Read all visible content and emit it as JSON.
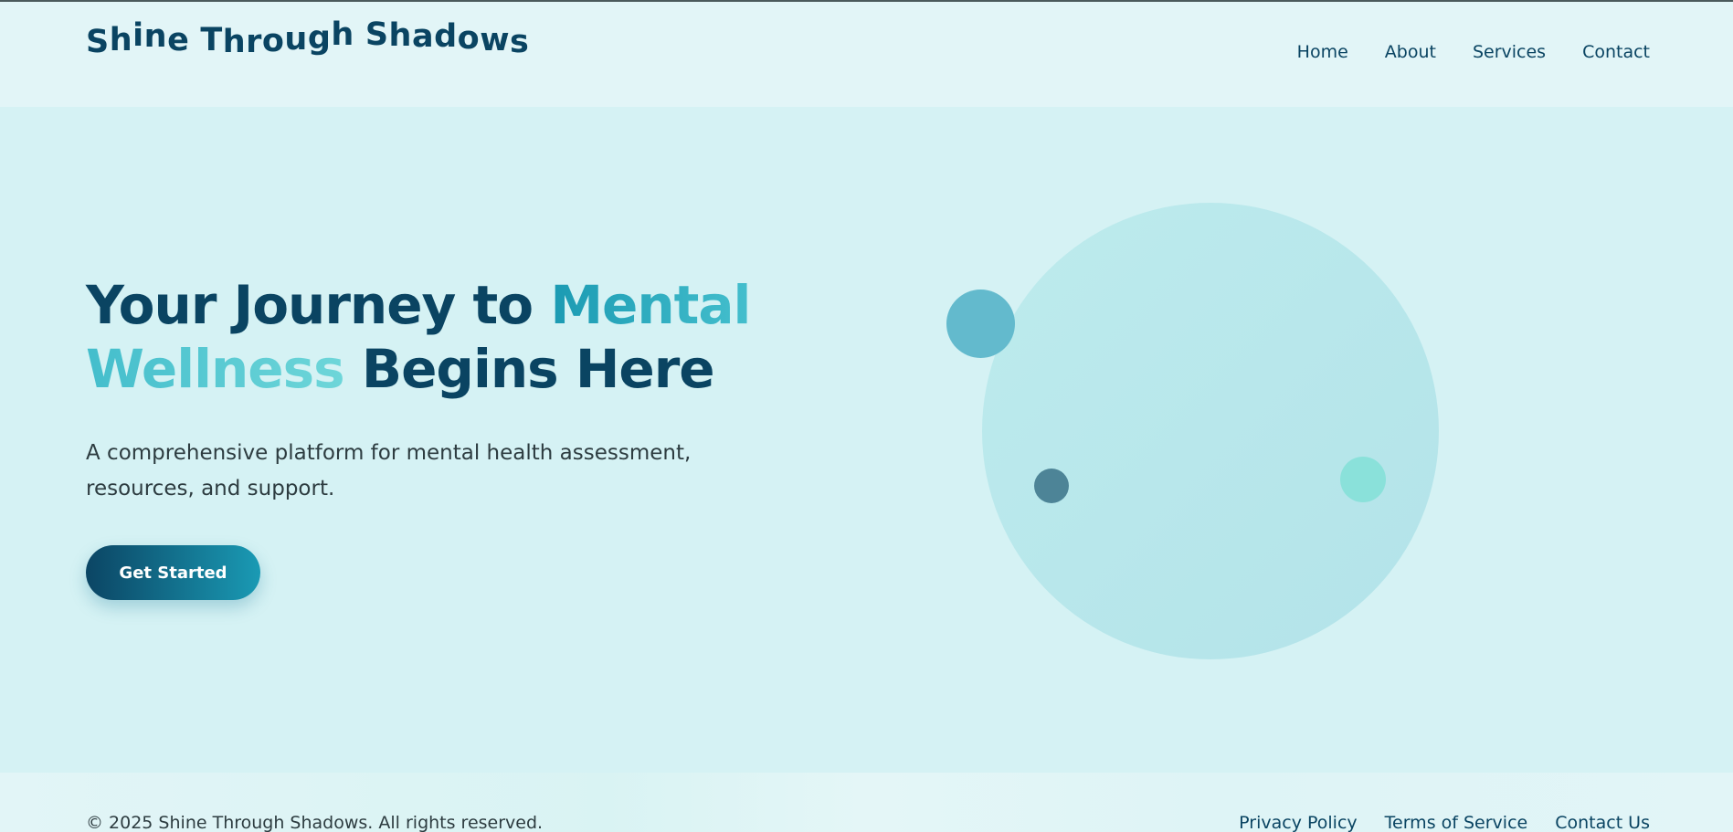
{
  "header": {
    "logo_letters": [
      "S",
      "h",
      "i",
      "n",
      "e",
      " ",
      "T",
      "h",
      "r",
      "o",
      "u",
      "g",
      "h",
      " ",
      "S",
      "h",
      "a",
      "d",
      "o",
      "w",
      "s"
    ],
    "nav": [
      {
        "label": "Home"
      },
      {
        "label": "About"
      },
      {
        "label": "Services"
      },
      {
        "label": "Contact"
      }
    ]
  },
  "hero": {
    "title_part1": "Your Journey to ",
    "title_highlight": "Mental Wellness",
    "title_part2": " Begins Here",
    "subtitle": "A comprehensive platform for mental health assessment, resources, and support.",
    "cta_label": "Get Started"
  },
  "footer": {
    "copyright": "© 2025 Shine Through Shadows. All rights reserved.",
    "links": [
      {
        "label": "Privacy Policy"
      },
      {
        "label": "Terms of Service"
      },
      {
        "label": "Contact Us"
      }
    ]
  },
  "colors": {
    "brand_dark": "#0a4462",
    "accent": "#1a9ab4",
    "accent_light": "#6ed6d9",
    "background": "#d5f2f4",
    "header_bg": "#e2f5f7"
  }
}
